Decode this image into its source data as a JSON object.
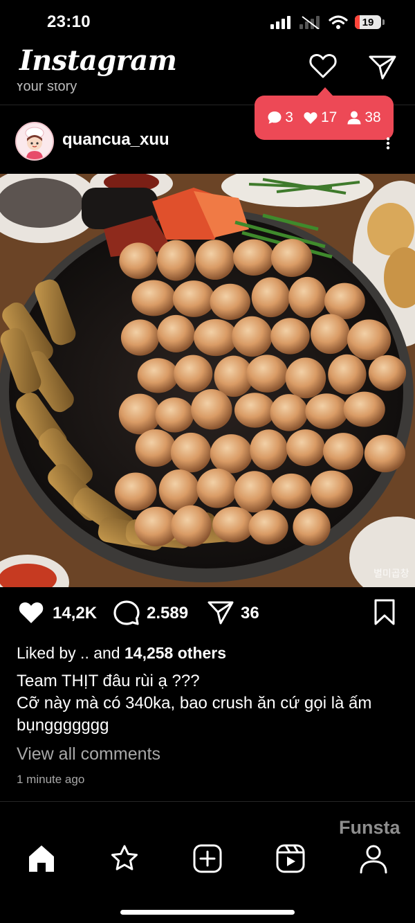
{
  "status_bar": {
    "time": "23:10",
    "battery_level": "19",
    "battery_fraction": 0.19
  },
  "header": {
    "logo": "Instagram",
    "story_peek": "Your story",
    "icons": [
      "heart-icon",
      "send-icon"
    ]
  },
  "notification": {
    "comments": "3",
    "likes": "17",
    "followers": "38",
    "color": "#ed4956"
  },
  "post": {
    "username": "quancua_xuu",
    "image_watermark": "별미곱창",
    "likes": "14,2K",
    "comments": "2.589",
    "shares": "36",
    "liked_by_prefix": "Liked by .. and ",
    "liked_by_others": "14,258 others",
    "caption": "Team THỊT đâu rùi ạ ???\nCỡ này mà có 340ka, bao crush ăn cứ gọi là ấm bụnggggggg",
    "view_comments": "View all comments",
    "time_ago": "1 minute ago"
  },
  "watermark": "Funsta",
  "bottom_nav": [
    "home-icon",
    "star-icon",
    "create-icon",
    "reels-icon",
    "profile-icon"
  ]
}
